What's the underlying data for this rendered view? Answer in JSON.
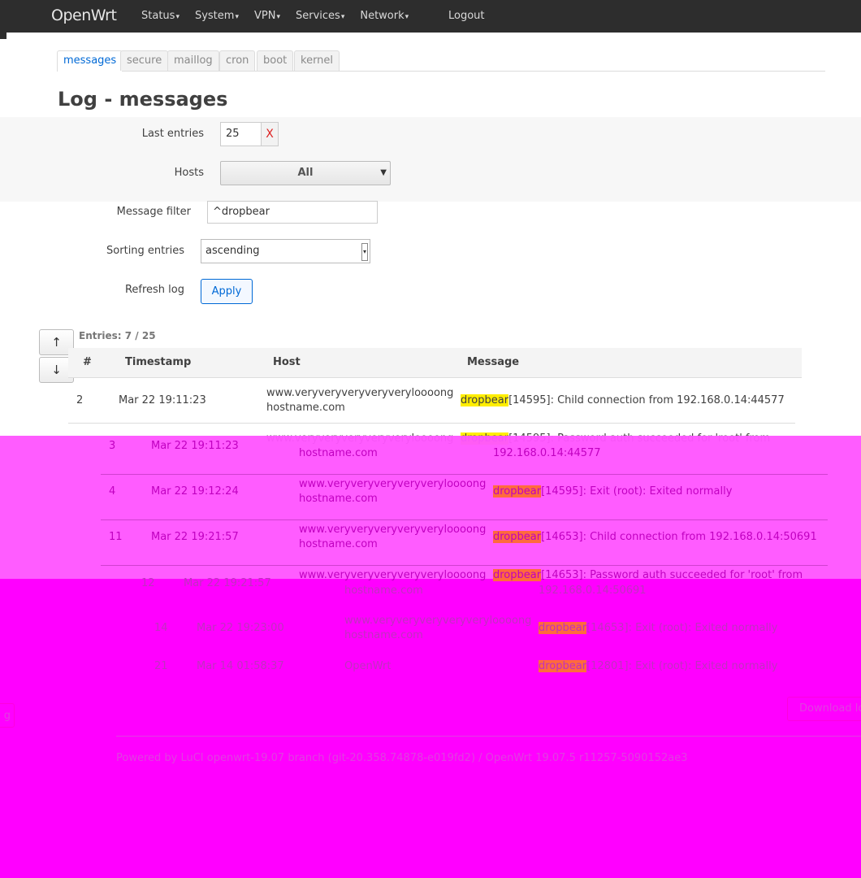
{
  "nav": {
    "brand": "OpenWrt",
    "menu": [
      {
        "label": "Status"
      },
      {
        "label": "System"
      },
      {
        "label": "VPN"
      },
      {
        "label": "Services"
      },
      {
        "label": "Network"
      }
    ],
    "logout": "Logout"
  },
  "tabs": [
    {
      "label": "messages",
      "active": true
    },
    {
      "label": "secure"
    },
    {
      "label": "maillog"
    },
    {
      "label": "cron"
    },
    {
      "label": "boot"
    },
    {
      "label": "kernel"
    }
  ],
  "page_title": "Log - messages",
  "form": {
    "last_entries_label": "Last entries",
    "last_entries_value": "25",
    "clear_label": "X",
    "hosts_label": "Hosts",
    "hosts_value": "All",
    "filter_label": "Message filter",
    "filter_value": "^dropbear",
    "sorting_label": "Sorting entries",
    "sorting_value": "ascending",
    "refresh_label": "Refresh log",
    "apply_label": "Apply"
  },
  "scroll": {
    "up": "↑",
    "down": "↓"
  },
  "entries_text": "Entries: 7 / 25",
  "table": {
    "headers": [
      "#",
      "Timestamp",
      "Host",
      "Message"
    ],
    "rows": [
      {
        "num": "2",
        "ts": "Mar 22 19:11:23",
        "host1": "www.veryveryveryveryveryloooong",
        "host2": "hostname.com",
        "prog": "dropbear",
        "msg1": "[14595]: Child connection from 192.168.0.14:44577",
        "msg2": ""
      },
      {
        "num": "3",
        "ts": "Mar 22 19:11:23",
        "host1": "www.veryveryveryveryveryloooong",
        "host2": "hostname.com",
        "prog": "dropbear",
        "msg1": "[14595]: Password auth succeeded for 'root' from",
        "msg2": "192.168.0.14:44577"
      },
      {
        "num": "4",
        "ts": "Mar 22 19:12:24",
        "host1": "www.veryveryveryveryveryloooong",
        "host2": "hostname.com",
        "prog": "dropbear",
        "msg1": "[14595]: Exit (root): Exited normally",
        "msg2": ""
      },
      {
        "num": "11",
        "ts": "Mar 22 19:21:57",
        "host1": "www.veryveryveryveryveryloooong",
        "host2": "hostname.com",
        "prog": "dropbear",
        "msg1": "[14653]: Child connection from 192.168.0.14:50691",
        "msg2": ""
      },
      {
        "num": "12",
        "ts": "Mar 22 19:21:57",
        "host1": "www.veryveryveryveryveryloooong",
        "host2": "hostname.com",
        "prog": "dropbear",
        "msg1": "[14653]: Password auth succeeded for 'root' from",
        "msg2": "192.168.0.14:50691"
      },
      {
        "num": "14",
        "ts": "Mar 22 19:23:00",
        "host1": "www.veryveryveryveryveryloooong",
        "host2": "hostname.com",
        "prog": "dropbear",
        "msg1": "[14653]: Exit (root): Exited normally",
        "msg2": ""
      },
      {
        "num": "21",
        "ts": "Mar 14 01:58:37",
        "host1": "OpenWrt",
        "host2": "",
        "prog": "dropbear",
        "msg1": "[12801]: Exit (root): Exited normally",
        "msg2": ""
      }
    ]
  },
  "download_label": "Download log",
  "footer": "Powered by LuCI openwrt-19.07 branch (git-20.358.74878-e019fd2) / OpenWrt 19.07.5 r11257-5090152ae3",
  "colors": {
    "accent": "#0069d6",
    "highlight": "#ffee00",
    "overlay": "#ff00ff"
  }
}
